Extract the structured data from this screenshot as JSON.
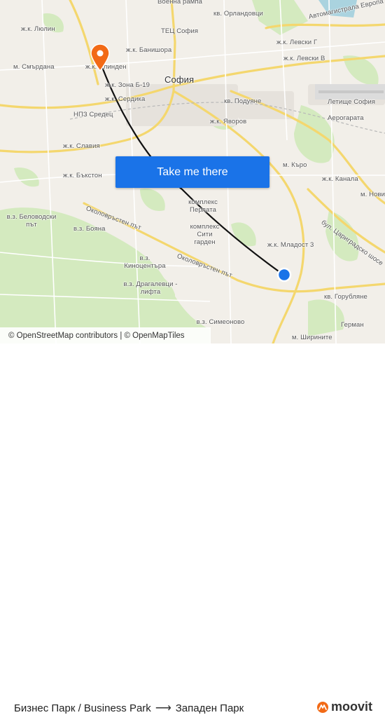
{
  "map": {
    "labels": {
      "voenna_rampa": "Военна рампа",
      "julin": "ж.к. Люлин",
      "orlandovtsi": "кв. Орландовци",
      "avtomagistrala": "Автомагистрала Европа",
      "tets_sofia": "ТЕЦ София",
      "banishora": "ж.к. Банишора",
      "levski_g": "ж.к. Левски Г",
      "levski_v": "ж.к. Левски В",
      "smardana": "м. Смърдана",
      "ilinden": "ж.к. Илинден",
      "zona_b19": "ж.к. Зона Б-19",
      "sofia": "София",
      "serdika": "ж.к. Сердика",
      "poduyane": "кв. Подуяне",
      "letishte": "Летище София",
      "npz_sredets": "НПЗ Средец",
      "yavorov": "ж.к. Яворов",
      "aerogarata": "Аерогарата",
      "slavia": "ж.к. Славия",
      "m_karo": "м. Къро",
      "bakston": "ж.к. Бъкстон",
      "kanala": "ж.к. Канала",
      "m_novi": "м. Нови",
      "kompleks_perlata": "комплекс Перлата",
      "belovodski": "в.з. Беловодски път",
      "okolovrasten1": "Околовръстен път",
      "boyana": "в.з. Бояна",
      "siti_garden": "комплекс Сити гарден",
      "tsarigradsko": "бул. Цариградско шосе",
      "mladost3": "ж.к. Младост 3",
      "kinotsentara": "в.з. Киноцентъра",
      "okolovrasten2": "Околовръстен път",
      "dragalevtsi": "в.з. Драгалевци - лифта",
      "gorublyane": "кв. Горубляне",
      "simeonovo": "в.з. Симеоново",
      "german": "Герман",
      "shirinite": "м. Ширините"
    },
    "attribution": "© OpenStreetMap contributors | © OpenMapTiles",
    "colors": {
      "route": "#111111",
      "origin": "#1a73e8",
      "destination": "#f26a16",
      "park": "#cde8b0",
      "road": "#f7e08c"
    }
  },
  "cta": {
    "label": "Take me there"
  },
  "footer": {
    "origin": "Бизнес Парк / Business Park",
    "arrow": "⟶",
    "destination": "Западен Парк",
    "brand": "moovit"
  },
  "icons": {
    "origin": "origin-dot-icon",
    "destination": "destination-pin-icon",
    "brand": "moovit-logo-icon"
  }
}
